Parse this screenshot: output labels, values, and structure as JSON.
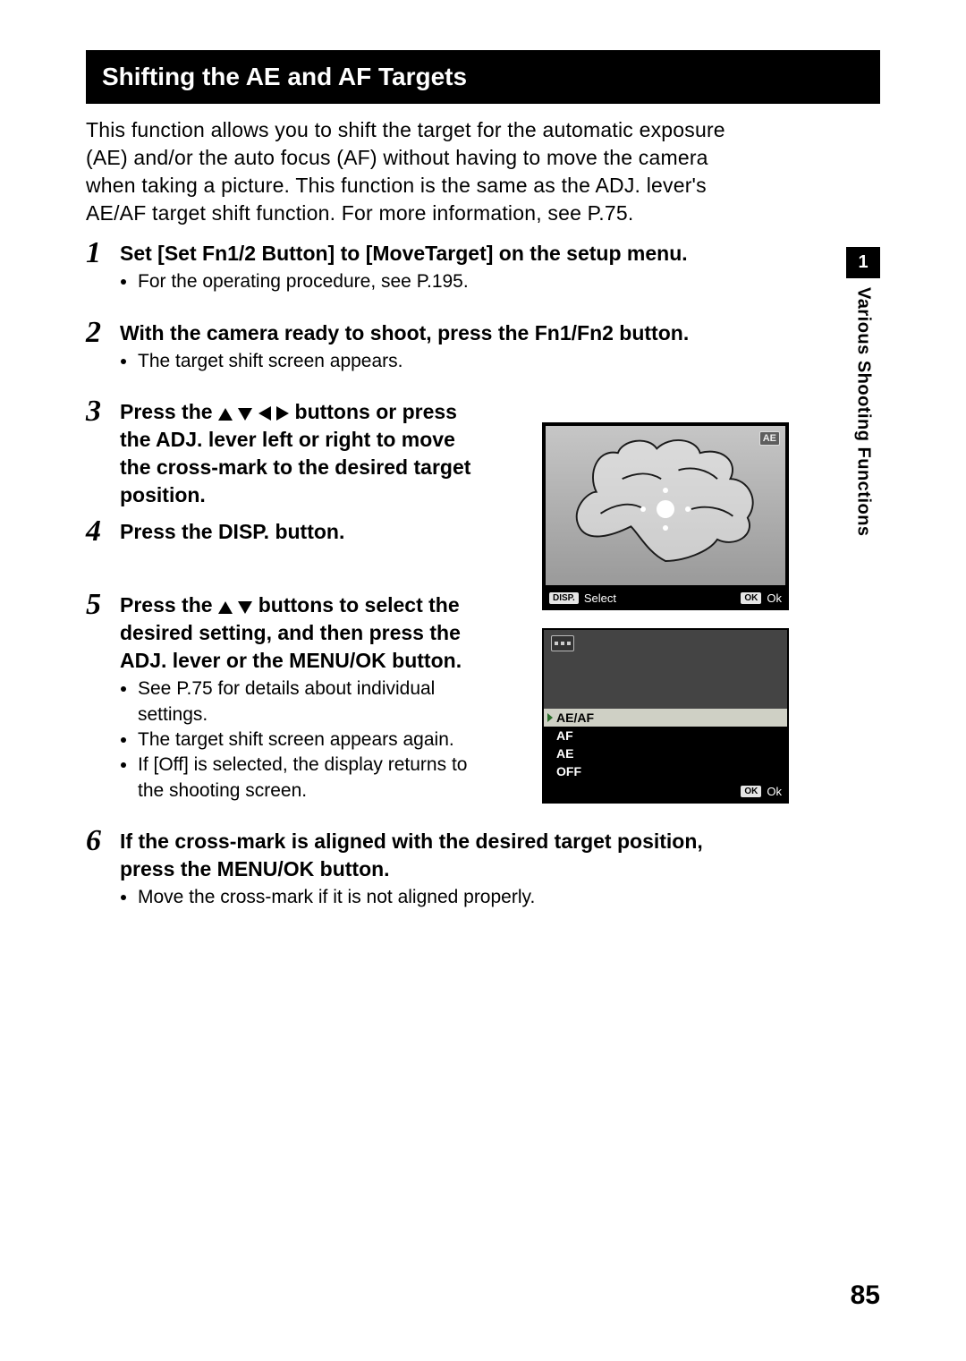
{
  "section_title": "Shifting the AE and AF Targets",
  "intro": "This function allows you to shift the target for the automatic exposure (AE) and/or the auto focus (AF) without having to move the camera when taking a picture. This function is the same as the ADJ. lever's AE/AF target shift function. For more information, see P.75.",
  "steps": [
    {
      "num": "1",
      "heading": "Set [Set Fn1/2 Button] to [MoveTarget] on the setup menu.",
      "bullets": [
        "For the operating procedure, see P.195."
      ]
    },
    {
      "num": "2",
      "heading": "With the camera ready to shoot, press the Fn1/Fn2 button.",
      "bullets": [
        "The target shift screen appears."
      ]
    },
    {
      "num": "3",
      "heading_pre": "Press the ",
      "heading_post": " buttons or press the ADJ. lever left or right to move the cross-mark to the desired target position.",
      "arrows": [
        "up",
        "down",
        "left",
        "right"
      ],
      "bullets": []
    },
    {
      "num": "4",
      "heading": "Press the DISP. button.",
      "bullets": []
    },
    {
      "num": "5",
      "heading_pre": "Press the ",
      "heading_post": " buttons to select the desired setting, and then press the ADJ. lever or the MENU/OK button.",
      "arrows": [
        "up",
        "down"
      ],
      "bullets": [
        "See P.75 for details about individual settings.",
        "The target shift screen appears again.",
        "If [Off] is selected, the display returns to the shooting screen."
      ]
    },
    {
      "num": "6",
      "heading": "If the cross-mark is aligned with the desired target position, press the MENU/OK button.",
      "bullets": [
        "Move the cross-mark if it is not aligned properly."
      ]
    }
  ],
  "figure1": {
    "ae_badge": "AE",
    "disp_badge": "DISP.",
    "disp_label": "Select",
    "ok_badge": "OK",
    "ok_label": "Ok"
  },
  "figure2": {
    "options": [
      "AE/AF",
      "AF",
      "AE",
      "OFF"
    ],
    "selected_index": 0,
    "ok_badge": "OK",
    "ok_label": "Ok"
  },
  "side_tab": {
    "num": "1",
    "label": "Various Shooting Functions"
  },
  "page_number": "85"
}
